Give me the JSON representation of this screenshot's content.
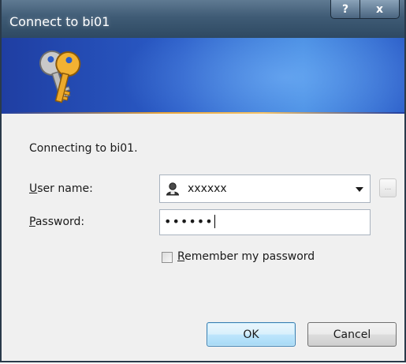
{
  "window": {
    "title": "Connect to bi01",
    "help_label": "?",
    "close_label": "x"
  },
  "banner": {
    "icon": "keys-icon"
  },
  "form": {
    "connecting_text": "Connecting to bi01.",
    "user_label_key": "U",
    "user_label_rest": "ser name:",
    "user_value": "xxxxxx",
    "user_icon": "user-icon",
    "browse_label": "...",
    "password_label_key": "P",
    "password_label_rest": "assword:",
    "password_value": "••••••",
    "remember_key": "R",
    "remember_rest": "emember my password",
    "remember_checked": false
  },
  "buttons": {
    "ok": "OK",
    "cancel": "Cancel"
  },
  "colors": {
    "banner_start": "#1f3ea2",
    "banner_end": "#3f86de",
    "accent_line": "#e8a53a",
    "ok_border": "#3c7fb1"
  }
}
